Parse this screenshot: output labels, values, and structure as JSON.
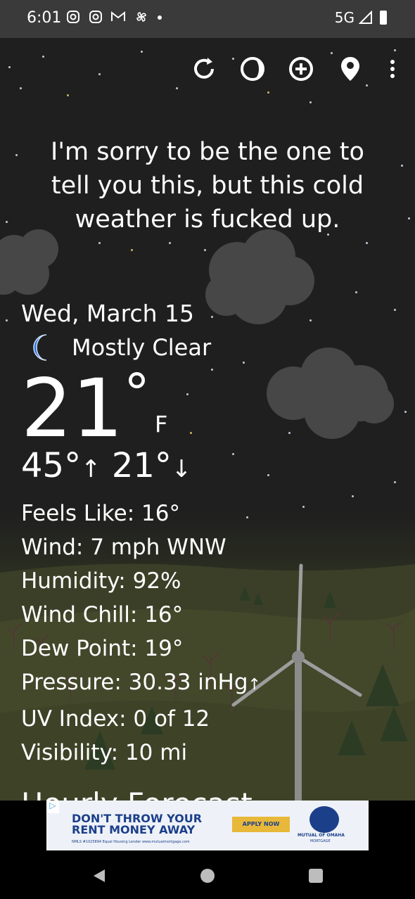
{
  "status_bar": {
    "time": "6:01",
    "left_icons": [
      "instagram-icon",
      "instagram-icon",
      "gmail-icon",
      "pinwheel-icon",
      "dot-icon"
    ],
    "network": "5G",
    "icons_right": [
      "signal-icon",
      "battery-icon"
    ]
  },
  "toolbar": {
    "icons": [
      "refresh-icon",
      "moon-phase-icon",
      "add-icon",
      "location-pin-icon",
      "more-vert-icon"
    ]
  },
  "headline": "I'm sorry to be the one to tell you this, but this cold weather is fucked up.",
  "weather": {
    "date": "Wed, March 15",
    "condition": "Mostly Clear",
    "condition_icon": "moon-icon",
    "temperature": "21",
    "degree": "°",
    "unit": "F",
    "high": "45°",
    "low": "21°",
    "high_arrow": "↑",
    "low_arrow": "↓"
  },
  "details": {
    "feels_like": "Feels Like:  16°",
    "wind": "Wind:  7 mph WNW",
    "humidity": "Humidity:  92%",
    "wind_chill": "Wind Chill:  16°",
    "dew_point": "Dew Point:  19°",
    "pressure": "Pressure:  30.33 inHg",
    "pressure_arrow": "↑",
    "uv_index": "UV Index:  0 of 12",
    "visibility": "Visibility:  10 mi"
  },
  "hourly_heading": "Hourly Forecast",
  "ad": {
    "headline_1": "DON'T THROW YOUR",
    "headline_2": "RENT MONEY AWAY",
    "cta": "APPLY NOW",
    "brand_1": "MUTUAL OF OMAHA",
    "brand_2": "MORTGAGE",
    "fine_print": "NMLS #1025894 Equal Housing Lender www.mutualmortgage.com"
  },
  "navbar": {
    "icons": [
      "back-icon",
      "home-icon",
      "recents-icon"
    ]
  },
  "colors": {
    "background": "#1f1f1f",
    "text": "#ffffff",
    "moon_blue": "#2a6fd6",
    "ad_blue": "#1c3f8a",
    "ad_cta": "#e8b83a"
  }
}
